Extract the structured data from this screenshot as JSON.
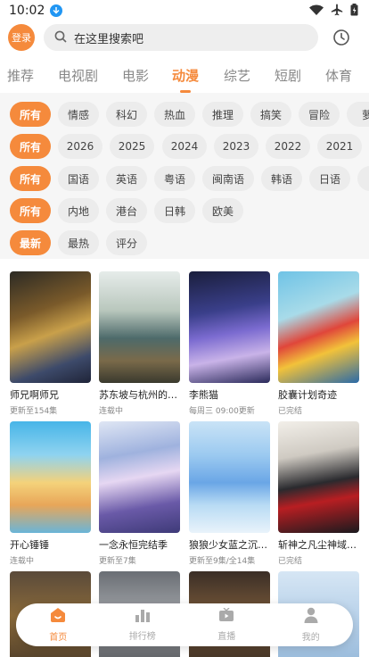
{
  "status": {
    "time": "10:02"
  },
  "header": {
    "login": "登录",
    "search_placeholder": "在这里搜索吧"
  },
  "tabs": [
    {
      "label": "推荐"
    },
    {
      "label": "电视剧"
    },
    {
      "label": "电影"
    },
    {
      "label": "动漫",
      "active": true
    },
    {
      "label": "综艺"
    },
    {
      "label": "短剧"
    },
    {
      "label": "体育"
    }
  ],
  "filters": [
    [
      "所有",
      "情感",
      "科幻",
      "热血",
      "推理",
      "搞笑",
      "冒险",
      "萝"
    ],
    [
      "所有",
      "2026",
      "2025",
      "2024",
      "2023",
      "2022",
      "2021"
    ],
    [
      "所有",
      "国语",
      "英语",
      "粤语",
      "闽南语",
      "韩语",
      "日语",
      "法"
    ],
    [
      "所有",
      "内地",
      "港台",
      "日韩",
      "欧美"
    ],
    [
      "最新",
      "最热",
      "评分"
    ]
  ],
  "cards": [
    {
      "title": "师兄啊师兄",
      "sub": "更新至154集"
    },
    {
      "title": "苏东坡与杭州的…",
      "sub": "连载中"
    },
    {
      "title": "李熊猫",
      "sub": "每周三 09:00更新"
    },
    {
      "title": "胶囊计划奇迹",
      "sub": "已完结"
    },
    {
      "title": "开心锤锤",
      "sub": "连载中"
    },
    {
      "title": "一念永恒完结季",
      "sub": "更新至7集"
    },
    {
      "title": "狼狼少女蓝之沉…",
      "sub": "更新至9集/全14集"
    },
    {
      "title": "斩神之凡尘神域…",
      "sub": "已完结"
    },
    {
      "title": "",
      "sub": ""
    },
    {
      "title": "",
      "sub": ""
    },
    {
      "title": "",
      "sub": ""
    },
    {
      "title": "",
      "sub": ""
    }
  ],
  "nav": [
    {
      "label": "首页",
      "icon": "home-icon",
      "active": true
    },
    {
      "label": "排行榜",
      "icon": "ranking-icon"
    },
    {
      "label": "直播",
      "icon": "live-icon"
    },
    {
      "label": "我的",
      "icon": "profile-icon"
    }
  ],
  "colors": {
    "accent": "#f58a3c"
  }
}
